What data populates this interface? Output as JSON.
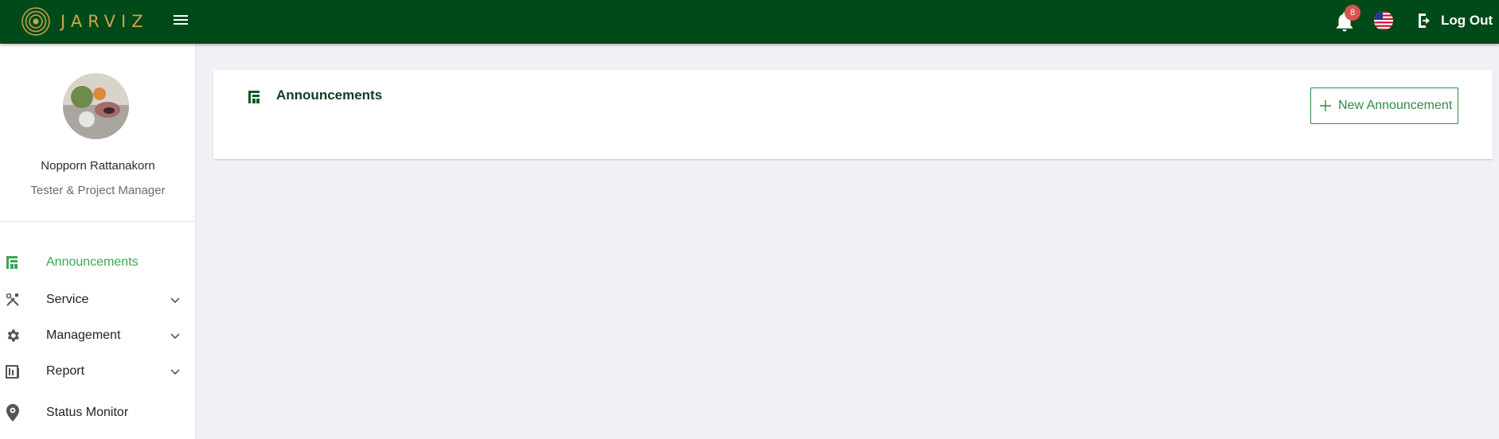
{
  "app": {
    "brand": "JARVIZ",
    "brand_color": "#c9a84a",
    "topbar_color": "#004a1a",
    "accent": "#3aa655"
  },
  "header": {
    "menu_icon": "hamburger-icon",
    "notifications": {
      "icon": "bell-icon",
      "count": "8"
    },
    "language_icon": "us-flag-icon",
    "logout_label": "Log Out",
    "logout_icon": "logout-icon"
  },
  "user": {
    "name": "Nopporn Rattanakorn",
    "role": "Tester & Project Manager"
  },
  "sidebar": {
    "items": [
      {
        "label": "Announcements",
        "icon": "announcement-icon",
        "active": true,
        "expandable": false
      },
      {
        "label": "Service",
        "icon": "tools-icon",
        "active": false,
        "expandable": true
      },
      {
        "label": "Management",
        "icon": "gear-icon",
        "active": false,
        "expandable": true
      },
      {
        "label": "Report",
        "icon": "report-icon",
        "active": false,
        "expandable": true
      },
      {
        "label": "Status Monitor",
        "icon": "location-pin-icon",
        "active": false,
        "expandable": false
      }
    ]
  },
  "main": {
    "title": "Announcements",
    "new_button_label": "New Announcement"
  }
}
